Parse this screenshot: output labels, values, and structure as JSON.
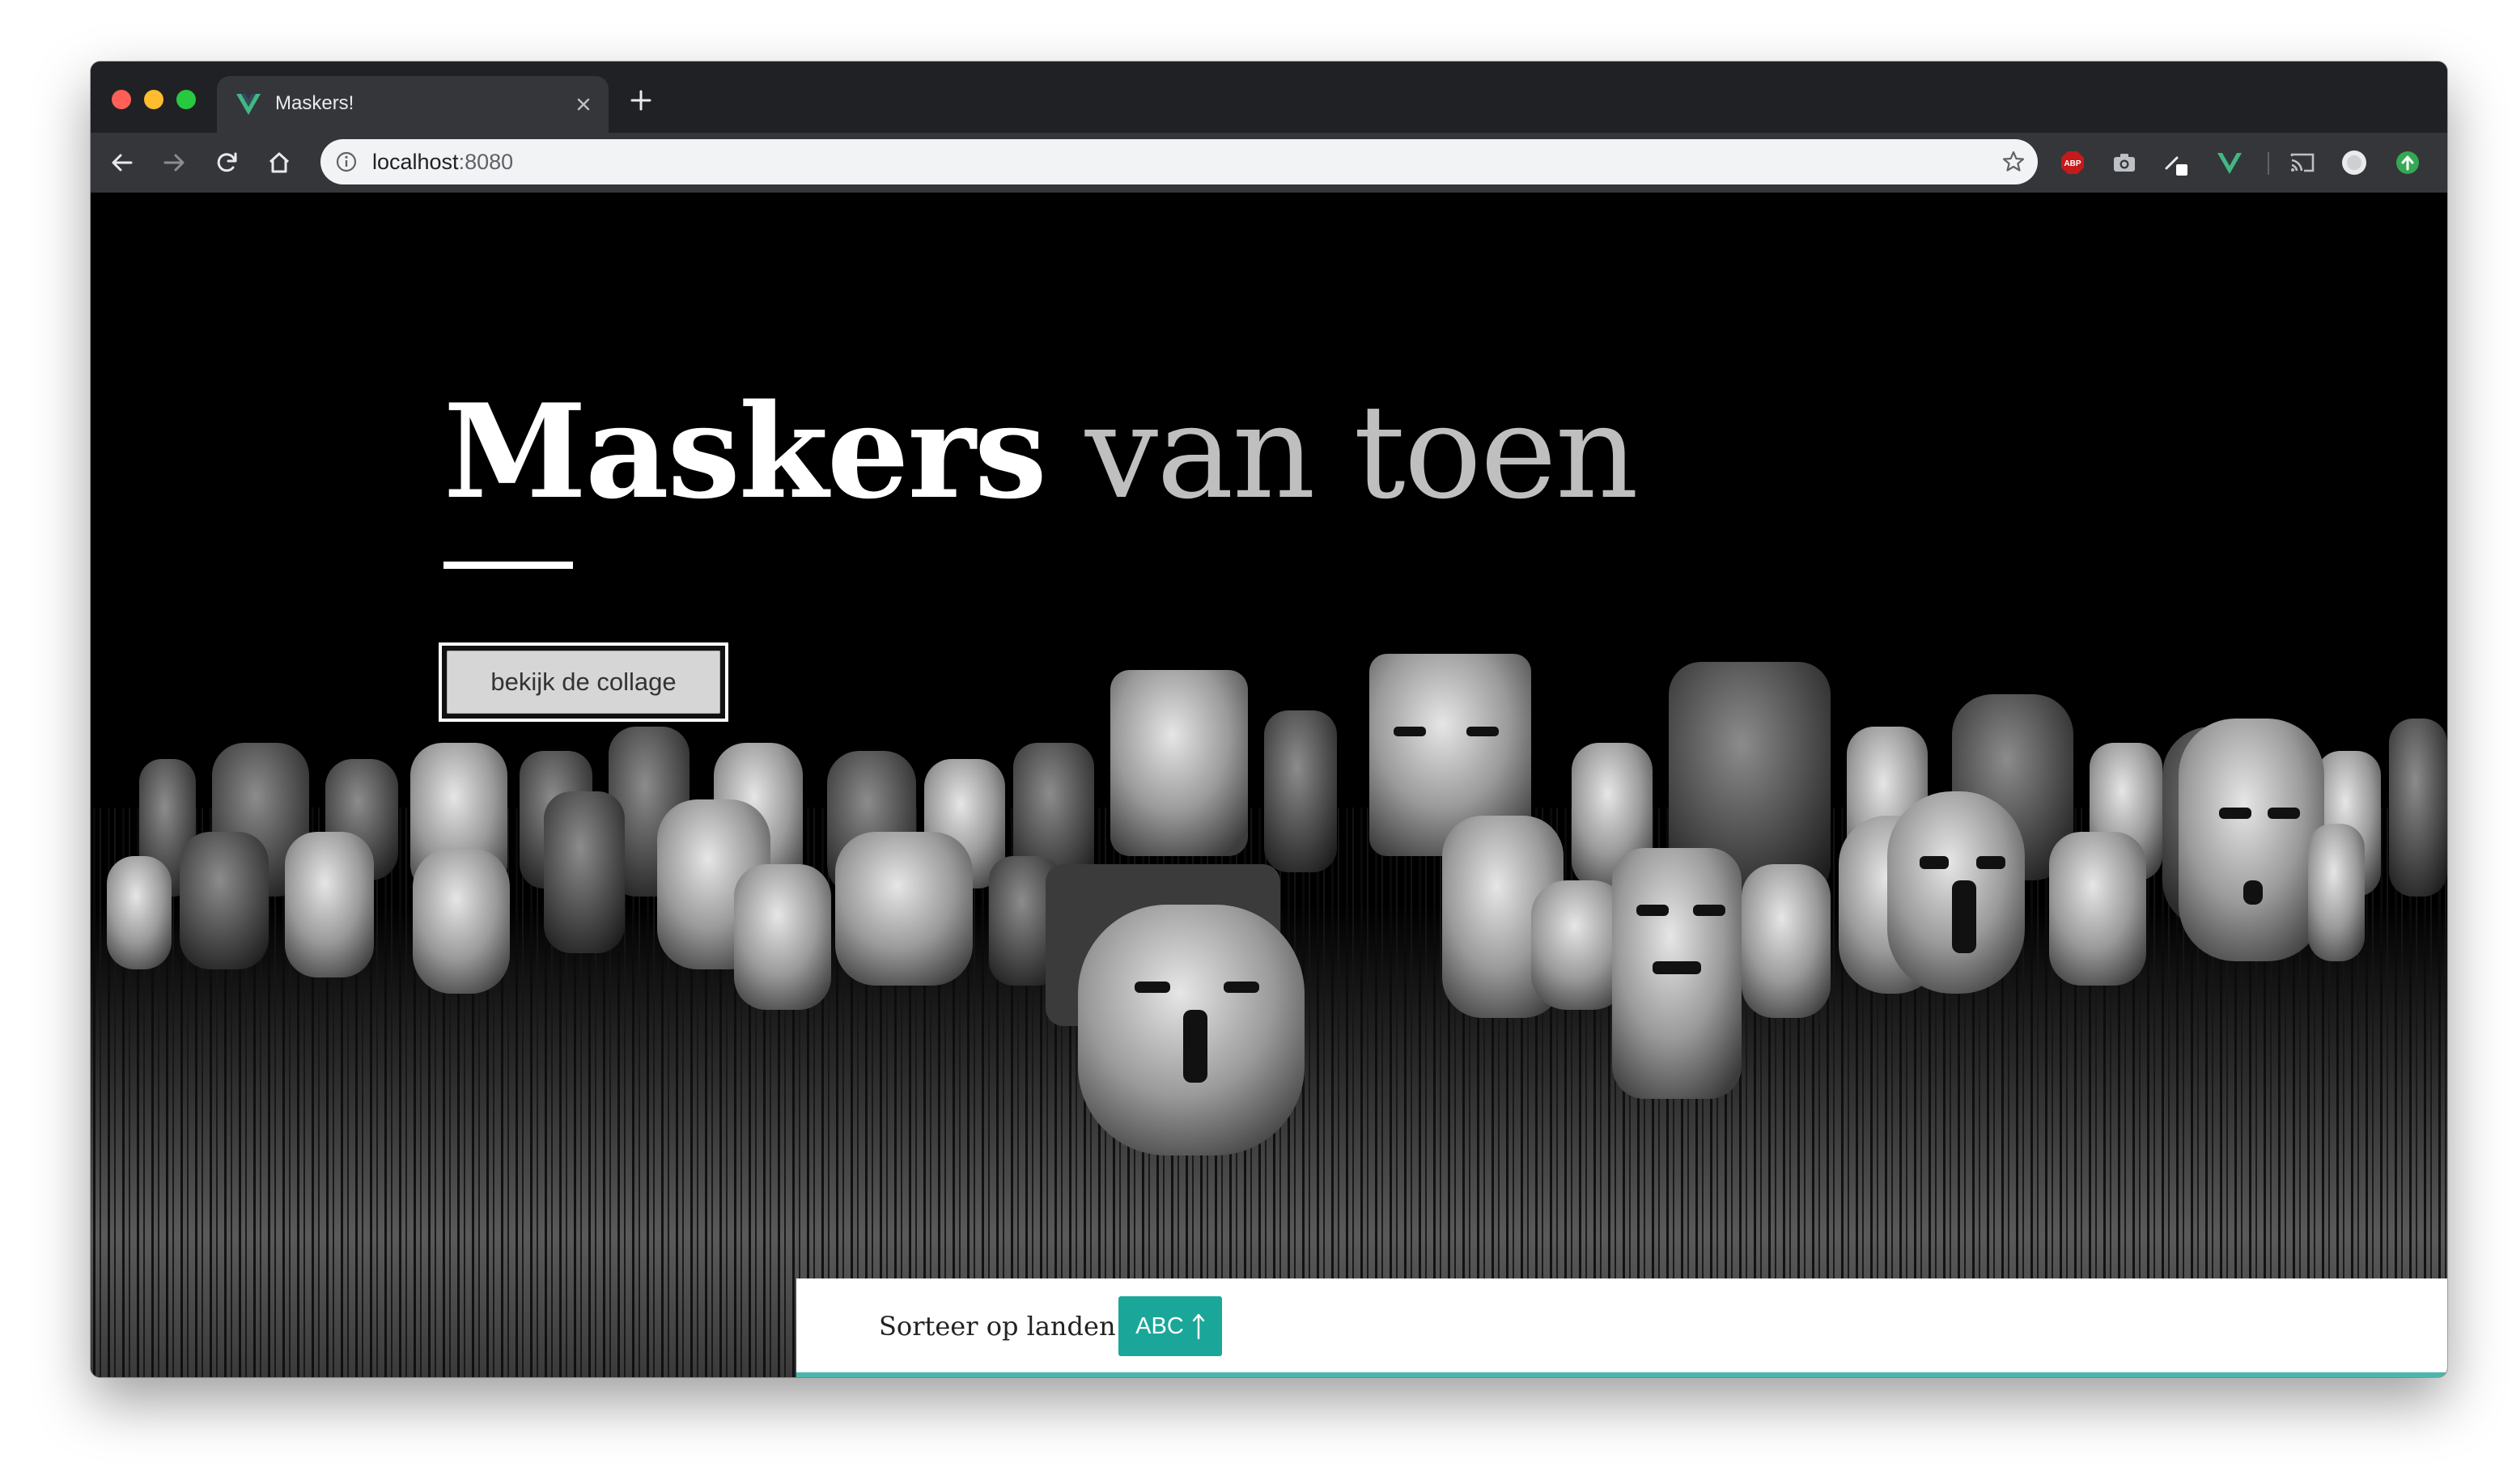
{
  "browser": {
    "tab_title": "Maskers!",
    "url_host": "localhost",
    "url_port": ":8080",
    "extensions": [
      "adblock-plus-icon",
      "camera-icon",
      "color-picker-icon",
      "vue-devtools-icon",
      "cast-icon",
      "profile-avatar-icon",
      "update-icon"
    ]
  },
  "hero": {
    "title_main": "Maskers",
    "title_rest": "van toen",
    "collage_button": "bekijk de collage"
  },
  "sort": {
    "label": "Sorteer op landen:",
    "button": "ABC",
    "direction_icon": "arrow-up-icon"
  },
  "colors": {
    "accent": "#1aa79a",
    "accent_border": "#4db6ac",
    "vue_green": "#41b883"
  }
}
